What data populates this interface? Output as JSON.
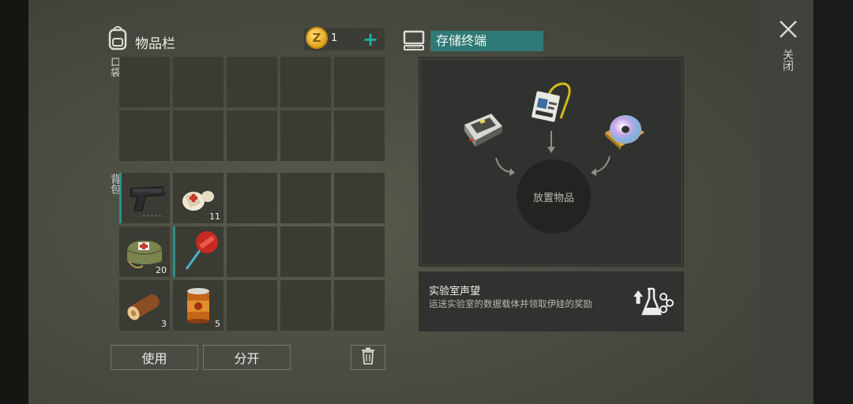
{
  "inventory": {
    "title": "物品栏",
    "pocket_label": "口袋",
    "backpack_label": "背包",
    "backpack_icon": "backpack-icon",
    "pocket_slots": 10,
    "backpack_items": [
      {
        "name": "pistol",
        "count": ""
      },
      {
        "name": "bandage",
        "count": "11"
      },
      {
        "name": "",
        "count": ""
      },
      {
        "name": "",
        "count": ""
      },
      {
        "name": "",
        "count": ""
      },
      {
        "name": "first-aid-kit",
        "count": "20"
      },
      {
        "name": "lollipop",
        "count": ""
      },
      {
        "name": "",
        "count": ""
      },
      {
        "name": "",
        "count": ""
      },
      {
        "name": "",
        "count": ""
      },
      {
        "name": "log",
        "count": "3"
      },
      {
        "name": "canned-food",
        "count": "5"
      },
      {
        "name": "",
        "count": ""
      },
      {
        "name": "",
        "count": ""
      },
      {
        "name": "",
        "count": ""
      }
    ],
    "use_label": "使用",
    "split_label": "分开",
    "trash_icon": "trash-icon"
  },
  "currency": {
    "coin_symbol": "Z",
    "amount": "1",
    "add_symbol": "+"
  },
  "terminal": {
    "icon": "computer-icon",
    "title": "存储终端",
    "drop_label": "放置物品",
    "items": [
      "hard-drive",
      "id-badge",
      "cd-disc"
    ]
  },
  "reputation": {
    "title": "实验室声望",
    "description": "运送实验室的数据载体并领取伊娃的奖励",
    "icon": "lab-flask-icon"
  },
  "window": {
    "close_label": "关闭",
    "close_icon": "close-icon"
  },
  "colors": {
    "accent_teal": "#2e7a76",
    "plus_teal": "#19b3a6",
    "coin_gold": "#e2a21d"
  }
}
